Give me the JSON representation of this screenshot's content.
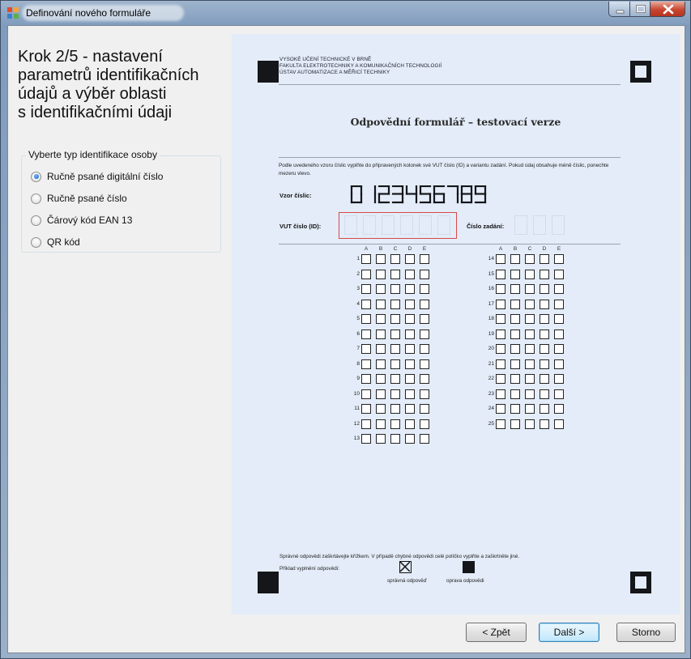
{
  "window": {
    "title": "Definování nového formuláře",
    "controls": [
      "minimize",
      "maximize",
      "close"
    ]
  },
  "step_title": "Krok 2/5 - nastavení parametrů identifikačních údajů a výběr oblasti s identifikačními údaji",
  "step_title_lines": [
    "Krok 2/5 - nastavení",
    "parametrů identifikačních",
    "údajů a výběr oblasti",
    "s identifikačními údaji"
  ],
  "identification": {
    "legend": "Vyberte typ identifikace osoby",
    "options": [
      {
        "label": "Ručně psané digitální číslo",
        "checked": true
      },
      {
        "label": "Ručně psané číslo",
        "checked": false
      },
      {
        "label": "Čárový kód EAN 13",
        "checked": false
      },
      {
        "label": "QR kód",
        "checked": false
      }
    ]
  },
  "preview": {
    "org_lines": [
      "VYSOKÉ UČENÍ TECHNICKÉ V BRNĚ",
      "FAKULTA ELEKTROTECHNIKY A KOMUNIKAČNÍCH TECHNOLOGIÍ",
      "ÚSTAV AUTOMATIZACE A MĚŘICÍ TECHNIKY"
    ],
    "form_title": "Odpovědní formulář – testovací verze",
    "instructions": "Podle uvedeného vzoru číslic vyplňte do připravených kolonek své VUT číslo (ID) a variantu zadání. Pokud údaj obsahuje méně číslic, ponechte mezeru vlevo.",
    "sample_label": "Vzor číslic:",
    "sample_digits": "0123456789",
    "id_label": "VUT číslo (ID):",
    "variant_label": "Číslo zadání:",
    "answer_columns": [
      "A",
      "B",
      "C",
      "D",
      "E"
    ],
    "question_count": 25,
    "footer_text": "Správné odpovědi zaškrtávejte křížkem. V případě chybné odpovědi celé políčko vyplňte a zaškrtněte jiné.",
    "example_label": "Příklad vyplnění odpovědi:",
    "correct_label": "správná odpověď",
    "fix_label": "oprava odpovědi"
  },
  "buttons": {
    "back": "< Zpět",
    "next": "Další >",
    "cancel": "Storno"
  },
  "colors": {
    "preview_bg": "#e3ecf8",
    "id_box_border": "#d64a4a",
    "radio_selected": "#1a5fbf"
  }
}
